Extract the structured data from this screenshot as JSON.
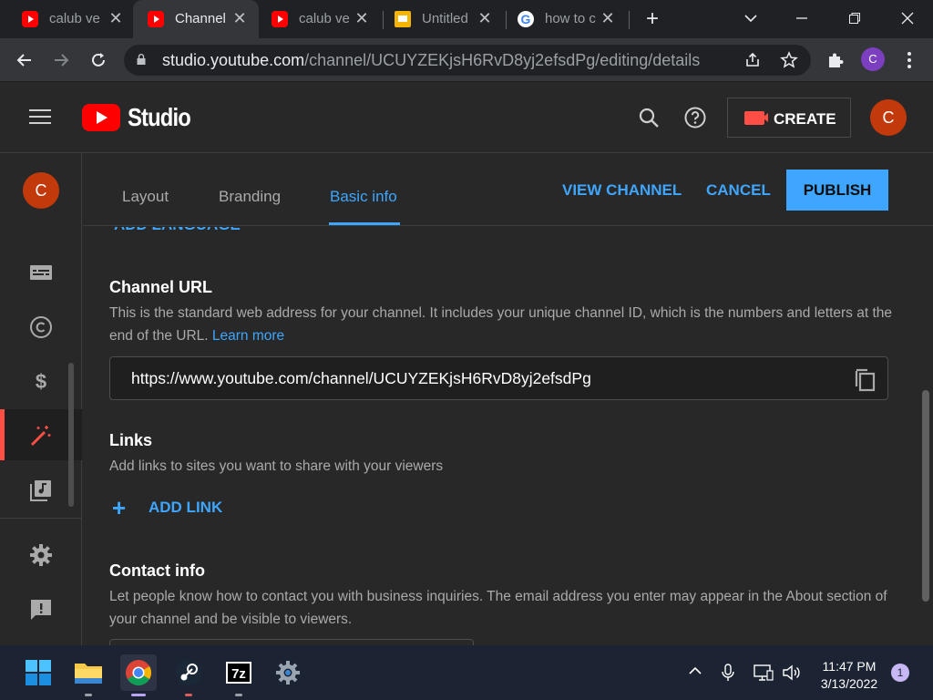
{
  "browser": {
    "tabs": [
      {
        "title": "calub ve",
        "favicon": "youtube-icon",
        "active": false
      },
      {
        "title": "Channel",
        "favicon": "youtube-icon",
        "active": true
      },
      {
        "title": "calub ve",
        "favicon": "youtube-icon",
        "active": false
      },
      {
        "title": "Untitled",
        "favicon": "google-slides-icon",
        "active": false
      },
      {
        "title": "how to c",
        "favicon": "google-icon",
        "active": false
      }
    ],
    "url_host": "studio.youtube.com",
    "url_path": "/channel/UCUYZEKjsH6RvD8yj2efsdPg/editing/details",
    "profile_initial": "C"
  },
  "studio": {
    "logo_text": "Studio",
    "create_label": "CREATE",
    "avatar_initial": "C"
  },
  "rail": {
    "avatar_initial": "C",
    "items": [
      "subtitles-icon",
      "copyright-icon",
      "monetization-icon",
      "customization-icon",
      "audio-library-icon",
      "settings-icon",
      "feedback-icon"
    ],
    "active_item": "customization-icon"
  },
  "editor": {
    "tabs": [
      "Layout",
      "Branding",
      "Basic info"
    ],
    "active_tab": "Basic info",
    "view_channel": "VIEW CHANNEL",
    "cancel": "CANCEL",
    "publish": "PUBLISH",
    "partial_link": "ADD LANGUAGE",
    "channel_url": {
      "title": "Channel URL",
      "description": "This is the standard web address for your channel. It includes your unique channel ID, which is the numbers and letters at the end of the URL.",
      "learn_more": "Learn more",
      "value": "https://www.youtube.com/channel/UCUYZEKjsH6RvD8yj2efsdPg"
    },
    "links": {
      "title": "Links",
      "description": "Add links to sites you want to share with your viewers",
      "add_link": "ADD LINK"
    },
    "contact": {
      "title": "Contact info",
      "description": "Let people know how to contact you with business inquiries. The email address you enter may appear in the About section of your channel and be visible to viewers."
    }
  },
  "taskbar": {
    "time": "11:47 PM",
    "date": "3/13/2022",
    "notifications": "1",
    "apps": [
      "start-icon",
      "file-explorer-icon",
      "chrome-icon",
      "steam-icon",
      "7zip-icon",
      "settings-app-icon"
    ]
  }
}
